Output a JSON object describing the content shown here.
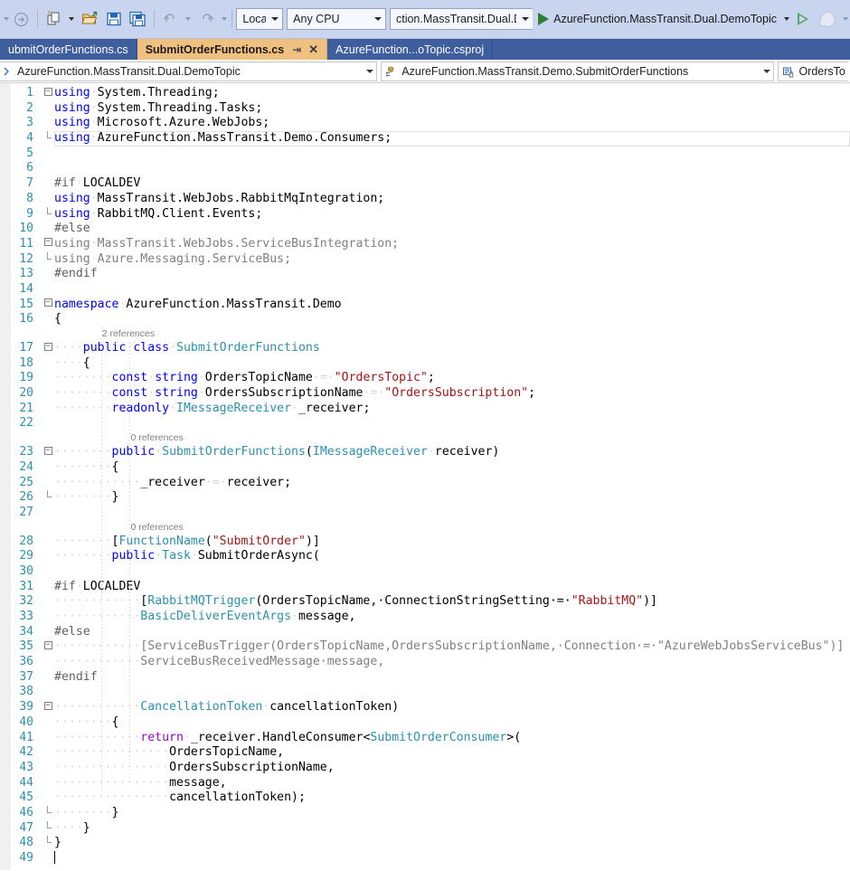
{
  "toolbar": {
    "icons": [
      {
        "name": "navigate-forward-icon",
        "glyph": "→"
      },
      {
        "name": "new-item-icon",
        "glyph": "▤"
      },
      {
        "name": "open-file-icon",
        "glyph": "📂"
      },
      {
        "name": "save-icon",
        "glyph": "💾"
      },
      {
        "name": "save-all-icon",
        "glyph": "💾"
      },
      {
        "name": "undo-icon",
        "glyph": "↶"
      },
      {
        "name": "redo-icon",
        "glyph": "↷"
      }
    ],
    "configuration": "LocalDev",
    "platform": "Any CPU",
    "startup_project": "ction.MassTransit.Dual.DemoTopic",
    "run_label": "AzureFunction.MassTransit.Dual.DemoTopic"
  },
  "tabs": [
    {
      "label": "ubmitOrderFunctions.cs",
      "active": false,
      "pinned": false,
      "closable": false
    },
    {
      "label": "SubmitOrderFunctions.cs",
      "active": true,
      "pinned": true,
      "closable": true
    },
    {
      "label": "AzureFunction...oTopic.csproj",
      "active": false,
      "pinned": false,
      "closable": false
    }
  ],
  "tab_glyphs": {
    "pin": "⇥",
    "close": "✕"
  },
  "navbar": {
    "project": "AzureFunction.MassTransit.Dual.DemoTopic",
    "type": "AzureFunction.MassTransit.Demo.SubmitOrderFunctions",
    "member": "OrdersTo",
    "type_icon": "class-icon",
    "member_icon": "field-icon",
    "project_icon": "project-icon"
  },
  "editor": {
    "lines": [
      {
        "n": 1,
        "fold": "minus",
        "vbar": false,
        "tokens": [
          {
            "t": "using",
            "c": "kw"
          },
          {
            "t": "·",
            "c": "dot"
          },
          {
            "t": "System.Threading;",
            "c": "plain"
          }
        ]
      },
      {
        "n": 2,
        "fold": "vbar",
        "tokens": [
          {
            "t": "using",
            "c": "kw"
          },
          {
            "t": "·",
            "c": "dot"
          },
          {
            "t": "System.Threading.Tasks;",
            "c": "plain"
          }
        ]
      },
      {
        "n": 3,
        "fold": "vbar",
        "tokens": [
          {
            "t": "using",
            "c": "kw"
          },
          {
            "t": "·",
            "c": "dot"
          },
          {
            "t": "Microsoft.Azure.WebJobs;",
            "c": "plain"
          }
        ]
      },
      {
        "n": 4,
        "fold": "vbarend",
        "current": true,
        "tokens": [
          {
            "t": "using",
            "c": "kw"
          },
          {
            "t": "·",
            "c": "dot"
          },
          {
            "t": "AzureFunction.MassTransit.Demo.Consumers;",
            "c": "plain"
          }
        ]
      },
      {
        "n": 5,
        "fold": "none",
        "tokens": []
      },
      {
        "n": 6,
        "fold": "none",
        "tokens": []
      },
      {
        "n": 7,
        "fold": "none",
        "tokens": [
          {
            "t": "#if",
            "c": "pp"
          },
          {
            "t": "·",
            "c": "dot"
          },
          {
            "t": "LOCALDEV",
            "c": "plain"
          }
        ]
      },
      {
        "n": 8,
        "fold": "vbar",
        "tokens": [
          {
            "t": "using",
            "c": "kw"
          },
          {
            "t": "·",
            "c": "dot"
          },
          {
            "t": "MassTransit.WebJobs.RabbitMqIntegration;",
            "c": "plain"
          }
        ]
      },
      {
        "n": 9,
        "fold": "vbarend",
        "tokens": [
          {
            "t": "using",
            "c": "kw"
          },
          {
            "t": "·",
            "c": "dot"
          },
          {
            "t": "RabbitMQ.Client.Events;",
            "c": "plain"
          }
        ]
      },
      {
        "n": 10,
        "fold": "none",
        "tokens": [
          {
            "t": "#else",
            "c": "pp"
          }
        ]
      },
      {
        "n": 11,
        "fold": "minus",
        "tokens": [
          {
            "t": "using",
            "c": "gray"
          },
          {
            "t": "·",
            "c": "dot"
          },
          {
            "t": "MassTransit.WebJobs.ServiceBusIntegration;",
            "c": "gray"
          }
        ]
      },
      {
        "n": 12,
        "fold": "vbarend",
        "tokens": [
          {
            "t": "using",
            "c": "gray"
          },
          {
            "t": "·",
            "c": "dot"
          },
          {
            "t": "Azure.Messaging.ServiceBus;",
            "c": "gray"
          }
        ]
      },
      {
        "n": 13,
        "fold": "none",
        "tokens": [
          {
            "t": "#endif",
            "c": "pp"
          }
        ]
      },
      {
        "n": 14,
        "fold": "none",
        "tokens": []
      },
      {
        "n": 15,
        "fold": "minus",
        "tokens": [
          {
            "t": "namespace",
            "c": "kw"
          },
          {
            "t": "·",
            "c": "dot"
          },
          {
            "t": "AzureFunction.MassTransit.Demo",
            "c": "plain"
          }
        ]
      },
      {
        "n": 16,
        "fold": "vbar",
        "tokens": [
          {
            "t": "{",
            "c": "plain"
          }
        ]
      },
      {
        "n": 17,
        "fold": "minus",
        "codelens": "2 references",
        "codelens_indent": 4,
        "tokens": [
          {
            "t": "····",
            "c": "dot"
          },
          {
            "t": "public",
            "c": "kw"
          },
          {
            "t": "·",
            "c": "dot"
          },
          {
            "t": "class",
            "c": "kw"
          },
          {
            "t": "·",
            "c": "dot"
          },
          {
            "t": "SubmitOrderFunctions",
            "c": "type"
          }
        ]
      },
      {
        "n": 18,
        "fold": "vbar",
        "tokens": [
          {
            "t": "····",
            "c": "dot"
          },
          {
            "t": "{",
            "c": "plain"
          }
        ]
      },
      {
        "n": 19,
        "fold": "vbar",
        "tokens": [
          {
            "t": "····",
            "c": "dot"
          },
          {
            "t": "····",
            "c": "dot"
          },
          {
            "t": "const",
            "c": "kw"
          },
          {
            "t": "·",
            "c": "dot"
          },
          {
            "t": "string",
            "c": "kw"
          },
          {
            "t": "·",
            "c": "dot"
          },
          {
            "t": "OrdersTopicName",
            "c": "plain"
          },
          {
            "t": "·=·",
            "c": "dot"
          },
          {
            "t": "\"OrdersTopic\"",
            "c": "str"
          },
          {
            "t": ";",
            "c": "plain"
          }
        ]
      },
      {
        "n": 20,
        "fold": "vbar",
        "tokens": [
          {
            "t": "····",
            "c": "dot"
          },
          {
            "t": "····",
            "c": "dot"
          },
          {
            "t": "const",
            "c": "kw"
          },
          {
            "t": "·",
            "c": "dot"
          },
          {
            "t": "string",
            "c": "kw"
          },
          {
            "t": "·",
            "c": "dot"
          },
          {
            "t": "OrdersSubscriptionName",
            "c": "plain"
          },
          {
            "t": "·=·",
            "c": "dot"
          },
          {
            "t": "\"OrdersSubscription\"",
            "c": "str"
          },
          {
            "t": ";",
            "c": "plain"
          }
        ]
      },
      {
        "n": 21,
        "fold": "vbar",
        "tokens": [
          {
            "t": "····",
            "c": "dot"
          },
          {
            "t": "····",
            "c": "dot"
          },
          {
            "t": "readonly",
            "c": "kw"
          },
          {
            "t": "·",
            "c": "dot"
          },
          {
            "t": "IMessageReceiver",
            "c": "type"
          },
          {
            "t": "·",
            "c": "dot"
          },
          {
            "t": "_receiver;",
            "c": "plain"
          }
        ]
      },
      {
        "n": 22,
        "fold": "vbar",
        "tokens": []
      },
      {
        "n": 23,
        "fold": "minus",
        "codelens": "0 references",
        "codelens_indent": 8,
        "tokens": [
          {
            "t": "····",
            "c": "dot"
          },
          {
            "t": "····",
            "c": "dot"
          },
          {
            "t": "public",
            "c": "kw"
          },
          {
            "t": "·",
            "c": "dot"
          },
          {
            "t": "SubmitOrderFunctions",
            "c": "type"
          },
          {
            "t": "(",
            "c": "plain"
          },
          {
            "t": "IMessageReceiver",
            "c": "type"
          },
          {
            "t": "·",
            "c": "dot"
          },
          {
            "t": "receiver)",
            "c": "plain"
          }
        ]
      },
      {
        "n": 24,
        "fold": "vbar",
        "tokens": [
          {
            "t": "····",
            "c": "dot"
          },
          {
            "t": "····",
            "c": "dot"
          },
          {
            "t": "{",
            "c": "plain"
          }
        ]
      },
      {
        "n": 25,
        "fold": "vbar",
        "tokens": [
          {
            "t": "····",
            "c": "dot"
          },
          {
            "t": "····",
            "c": "dot"
          },
          {
            "t": "····",
            "c": "dot"
          },
          {
            "t": "_receiver",
            "c": "plain"
          },
          {
            "t": "·=·",
            "c": "dot"
          },
          {
            "t": "receiver;",
            "c": "plain"
          }
        ]
      },
      {
        "n": 26,
        "fold": "vbarend",
        "tokens": [
          {
            "t": "····",
            "c": "dot"
          },
          {
            "t": "····",
            "c": "dot"
          },
          {
            "t": "}",
            "c": "plain"
          }
        ]
      },
      {
        "n": 27,
        "fold": "none",
        "tokens": []
      },
      {
        "n": 28,
        "fold": "none",
        "codelens": "0 references",
        "codelens_indent": 8,
        "codelens_below": true,
        "tokens": [
          {
            "t": "····",
            "c": "dot"
          },
          {
            "t": "····",
            "c": "dot"
          },
          {
            "t": "[",
            "c": "plain"
          },
          {
            "t": "FunctionName",
            "c": "type"
          },
          {
            "t": "(",
            "c": "plain"
          },
          {
            "t": "\"SubmitOrder\"",
            "c": "str"
          },
          {
            "t": ")]",
            "c": "plain"
          }
        ]
      },
      {
        "n": 29,
        "fold": "none",
        "tokens": [
          {
            "t": "····",
            "c": "dot"
          },
          {
            "t": "····",
            "c": "dot"
          },
          {
            "t": "public",
            "c": "kw"
          },
          {
            "t": "·",
            "c": "dot"
          },
          {
            "t": "Task",
            "c": "type"
          },
          {
            "t": "·",
            "c": "dot"
          },
          {
            "t": "SubmitOrderAsync(",
            "c": "plain"
          }
        ]
      },
      {
        "n": 30,
        "fold": "none",
        "tokens": []
      },
      {
        "n": 31,
        "fold": "none",
        "tokens": [
          {
            "t": "#if",
            "c": "pp"
          },
          {
            "t": "·",
            "c": "dot"
          },
          {
            "t": "LOCALDEV",
            "c": "plain"
          }
        ]
      },
      {
        "n": 32,
        "fold": "none",
        "tokens": [
          {
            "t": "····",
            "c": "dot"
          },
          {
            "t": "····",
            "c": "dot"
          },
          {
            "t": "····",
            "c": "dot"
          },
          {
            "t": "[",
            "c": "plain"
          },
          {
            "t": "RabbitMQTrigger",
            "c": "type"
          },
          {
            "t": "(OrdersTopicName,·ConnectionStringSetting·=·",
            "c": "plain"
          },
          {
            "t": "\"RabbitMQ\"",
            "c": "str"
          },
          {
            "t": ")]",
            "c": "plain"
          }
        ]
      },
      {
        "n": 33,
        "fold": "none",
        "tokens": [
          {
            "t": "····",
            "c": "dot"
          },
          {
            "t": "····",
            "c": "dot"
          },
          {
            "t": "····",
            "c": "dot"
          },
          {
            "t": "BasicDeliverEventArgs",
            "c": "type"
          },
          {
            "t": "·",
            "c": "dot"
          },
          {
            "t": "message,",
            "c": "plain"
          }
        ]
      },
      {
        "n": 34,
        "fold": "none",
        "tokens": [
          {
            "t": "#else",
            "c": "pp"
          }
        ]
      },
      {
        "n": 35,
        "fold": "minus",
        "tokens": [
          {
            "t": "····",
            "c": "dot"
          },
          {
            "t": "····",
            "c": "dot"
          },
          {
            "t": "····",
            "c": "dot"
          },
          {
            "t": "[ServiceBusTrigger(OrdersTopicName,OrdersSubscriptionName,·Connection·=·\"AzureWebJobsServiceBus\")]",
            "c": "gray"
          }
        ]
      },
      {
        "n": 36,
        "fold": "none",
        "tokens": [
          {
            "t": "····",
            "c": "dot"
          },
          {
            "t": "····",
            "c": "dot"
          },
          {
            "t": "····",
            "c": "dot"
          },
          {
            "t": "ServiceBusReceivedMessage·message,",
            "c": "gray"
          }
        ]
      },
      {
        "n": 37,
        "fold": "none",
        "tokens": [
          {
            "t": "#endif",
            "c": "pp"
          }
        ]
      },
      {
        "n": 38,
        "fold": "none",
        "tokens": []
      },
      {
        "n": 39,
        "fold": "minus",
        "tokens": [
          {
            "t": "····",
            "c": "dot"
          },
          {
            "t": "····",
            "c": "dot"
          },
          {
            "t": "····",
            "c": "dot"
          },
          {
            "t": "CancellationToken",
            "c": "type"
          },
          {
            "t": "·",
            "c": "dot"
          },
          {
            "t": "cancellationToken)",
            "c": "plain"
          }
        ]
      },
      {
        "n": 40,
        "fold": "vbar",
        "tokens": [
          {
            "t": "····",
            "c": "dot"
          },
          {
            "t": "····",
            "c": "dot"
          },
          {
            "t": "{",
            "c": "plain"
          }
        ]
      },
      {
        "n": 41,
        "fold": "vbar",
        "tokens": [
          {
            "t": "····",
            "c": "dot"
          },
          {
            "t": "····",
            "c": "dot"
          },
          {
            "t": "····",
            "c": "dot"
          },
          {
            "t": "return",
            "c": "kwc"
          },
          {
            "t": "·",
            "c": "dot"
          },
          {
            "t": "_receiver.",
            "c": "plain"
          },
          {
            "t": "HandleConsumer",
            "c": "plain"
          },
          {
            "t": "<",
            "c": "plain"
          },
          {
            "t": "SubmitOrderConsumer",
            "c": "type"
          },
          {
            "t": ">(",
            "c": "plain"
          }
        ]
      },
      {
        "n": 42,
        "fold": "vbar",
        "tokens": [
          {
            "t": "····",
            "c": "dot"
          },
          {
            "t": "····",
            "c": "dot"
          },
          {
            "t": "····",
            "c": "dot"
          },
          {
            "t": "····",
            "c": "dot"
          },
          {
            "t": "OrdersTopicName,",
            "c": "plain"
          }
        ]
      },
      {
        "n": 43,
        "fold": "vbar",
        "tokens": [
          {
            "t": "····",
            "c": "dot"
          },
          {
            "t": "····",
            "c": "dot"
          },
          {
            "t": "····",
            "c": "dot"
          },
          {
            "t": "····",
            "c": "dot"
          },
          {
            "t": "OrdersSubscriptionName,",
            "c": "plain"
          }
        ]
      },
      {
        "n": 44,
        "fold": "vbar",
        "tokens": [
          {
            "t": "····",
            "c": "dot"
          },
          {
            "t": "····",
            "c": "dot"
          },
          {
            "t": "····",
            "c": "dot"
          },
          {
            "t": "····",
            "c": "dot"
          },
          {
            "t": "message,",
            "c": "plain"
          }
        ]
      },
      {
        "n": 45,
        "fold": "vbar",
        "tokens": [
          {
            "t": "····",
            "c": "dot"
          },
          {
            "t": "····",
            "c": "dot"
          },
          {
            "t": "····",
            "c": "dot"
          },
          {
            "t": "····",
            "c": "dot"
          },
          {
            "t": "cancellationToken);",
            "c": "plain"
          }
        ]
      },
      {
        "n": 46,
        "fold": "vbarend",
        "tokens": [
          {
            "t": "····",
            "c": "dot"
          },
          {
            "t": "····",
            "c": "dot"
          },
          {
            "t": "}",
            "c": "plain"
          }
        ]
      },
      {
        "n": 47,
        "fold": "vbarend2",
        "tokens": [
          {
            "t": "····",
            "c": "dot"
          },
          {
            "t": "}",
            "c": "plain"
          }
        ]
      },
      {
        "n": 48,
        "fold": "vbarend3",
        "tokens": [
          {
            "t": "}",
            "c": "plain"
          }
        ]
      },
      {
        "n": 49,
        "fold": "none",
        "caret": true,
        "tokens": []
      }
    ]
  }
}
